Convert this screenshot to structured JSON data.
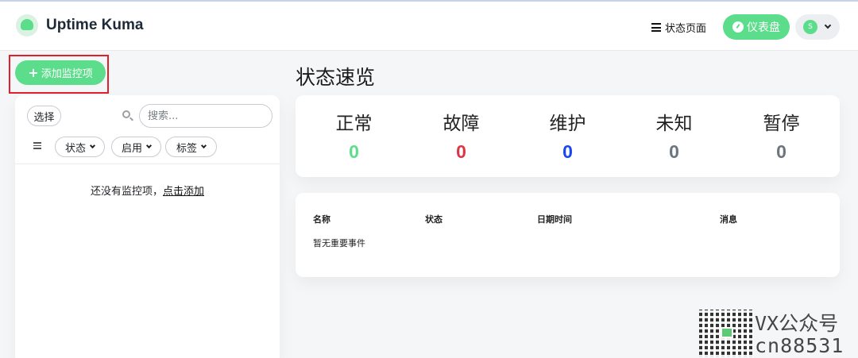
{
  "header": {
    "brand_title": "Uptime Kuma",
    "status_page_label": "状态页面",
    "dashboard_label": "仪表盘",
    "avatar_initial": "S",
    "accent_color": "#5cdd8b"
  },
  "sidebar": {
    "add_monitor_label": "添加监控项",
    "select_label": "选择",
    "search": {
      "placeholder": "搜索...",
      "value": ""
    },
    "filters": [
      {
        "label": "状态"
      },
      {
        "label": "启用"
      },
      {
        "label": "标签"
      }
    ],
    "empty_text": "还没有监控项，",
    "empty_link": "点击添加"
  },
  "main": {
    "overview_title": "状态速览",
    "stats": [
      {
        "label": "正常",
        "value": "0",
        "color": "#5cdd8b"
      },
      {
        "label": "故障",
        "value": "0",
        "color": "#dc3545"
      },
      {
        "label": "维护",
        "value": "0",
        "color": "#1747f5"
      },
      {
        "label": "未知",
        "value": "0",
        "color": "#6c757d"
      },
      {
        "label": "暂停",
        "value": "0",
        "color": "#6c757d"
      }
    ],
    "events": {
      "columns": [
        "名称",
        "状态",
        "日期时间",
        "消息"
      ],
      "empty_text": "暂无重要事件"
    }
  },
  "watermark": {
    "line1": "VX公众号",
    "line2": "cn88531"
  }
}
